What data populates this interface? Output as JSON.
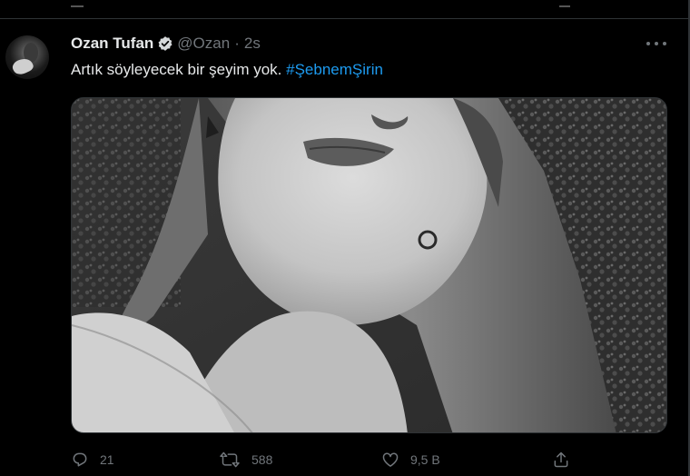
{
  "tweet": {
    "display_name": "Ozan Tufan",
    "handle": "@Ozan",
    "separator": "·",
    "time": "2s",
    "text": "Artık söyleyecek bir şeyim yok.",
    "hashtag": "#ŞebnemŞirin",
    "media_icon": "photo-grayscale-portrait",
    "actions": {
      "reply_count": "21",
      "retweet_count": "588",
      "like_count": "9,5 B"
    }
  },
  "colors": {
    "background": "#000000",
    "text": "#e7e9ea",
    "secondary": "#71767b",
    "link": "#1d9bf0",
    "border": "#2f3336"
  },
  "icons": [
    "verified-badge-icon",
    "more-icon",
    "reply-icon",
    "retweet-icon",
    "like-icon",
    "share-icon"
  ]
}
